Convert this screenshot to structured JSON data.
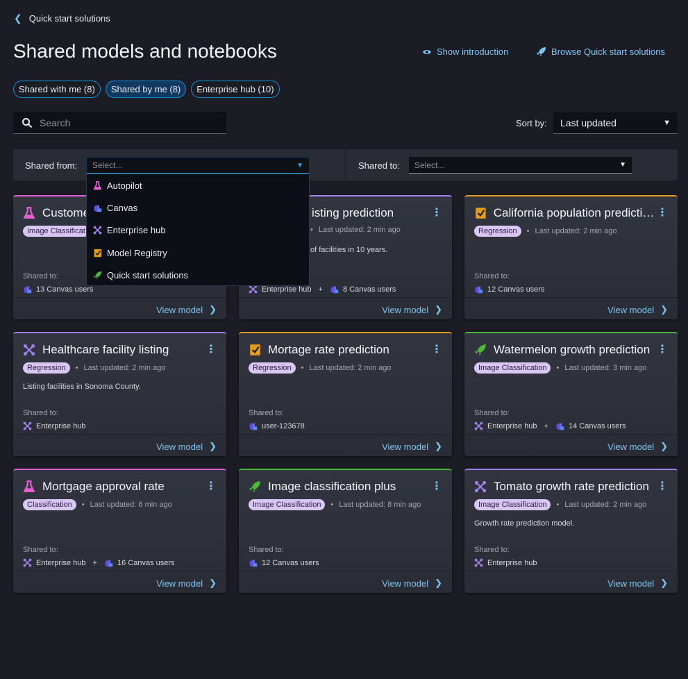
{
  "nav": {
    "back_label": "Quick start solutions"
  },
  "header": {
    "title": "Shared models and notebooks",
    "show_intro": "Show introduction",
    "browse": "Browse Quick start solutions"
  },
  "tabs": [
    {
      "label": "Shared with me (8)",
      "active": false
    },
    {
      "label": "Shared by me (8)",
      "active": true
    },
    {
      "label": "Enterprise hub (10)",
      "active": false
    }
  ],
  "search": {
    "placeholder": "Search"
  },
  "sort": {
    "label": "Sort by:",
    "value": "Last updated"
  },
  "filters": {
    "from_label": "Shared from:",
    "from_placeholder": "Select...",
    "to_label": "Shared to:",
    "to_placeholder": "Select..."
  },
  "dropdown": [
    {
      "icon": "autopilot",
      "label": "Autopilot"
    },
    {
      "icon": "canvas",
      "label": "Canvas"
    },
    {
      "icon": "hub",
      "label": "Enterprise hub"
    },
    {
      "icon": "registry",
      "label": "Model Registry"
    },
    {
      "icon": "quickstart",
      "label": "Quick start solutions"
    }
  ],
  "colors": {
    "autopilot": "#e45fd3",
    "hub": "#a37ff0",
    "registry": "#e39c1c",
    "quickstart": "#4bb83a",
    "canvas": "#6a5cf0",
    "link": "#7cc4f4"
  },
  "cards": [
    {
      "icon": "autopilot",
      "title": "Custome",
      "tag": "Image Classificat",
      "updated": "",
      "desc": "",
      "shared_label": "Shared to:",
      "shared": [
        {
          "icon": "canvas",
          "label": "13 Canvas users"
        }
      ],
      "view": "View model"
    },
    {
      "icon": "hub",
      "title": "isting prediction",
      "tag": "",
      "updated": "Last updated: 2 min ago",
      "desc": "of facilities in 10 years.",
      "shared_label": "Shared to:",
      "shared": [
        {
          "icon": "hub",
          "label": "Enterprise hub"
        },
        {
          "icon": "canvas",
          "label": "8 Canvas users"
        }
      ],
      "view": "View model",
      "partial": true
    },
    {
      "icon": "registry",
      "title": "California population predictio...",
      "tag": "Regression",
      "updated": "Last updated: 2 min ago",
      "desc": "",
      "shared_label": "Shared to:",
      "shared": [
        {
          "icon": "canvas",
          "label": "12 Canvas users"
        }
      ],
      "view": "View model"
    },
    {
      "icon": "hub",
      "title": "Healthcare facility listing",
      "tag": "Regression",
      "updated": "Last updated: 2 min ago",
      "desc": "Listing facilities in Sonoma County.",
      "shared_label": "Shared to:",
      "shared": [
        {
          "icon": "hub",
          "label": "Enterprise hub"
        }
      ],
      "view": "View model"
    },
    {
      "icon": "registry",
      "title": "Mortage rate prediction",
      "tag": "Regression",
      "updated": "Last updated: 2 min ago",
      "desc": "",
      "shared_label": "Shared to:",
      "shared": [
        {
          "icon": "canvas",
          "label": "user-123678"
        }
      ],
      "view": "View model"
    },
    {
      "icon": "quickstart",
      "title": "Watermelon growth prediction",
      "tag": "Image Classification",
      "updated": "Last updated: 3 min ago",
      "desc": "",
      "shared_label": "Shared to:",
      "shared": [
        {
          "icon": "hub",
          "label": "Enterprise hub"
        },
        {
          "icon": "canvas",
          "label": "14 Canvas users"
        }
      ],
      "view": "View model"
    },
    {
      "icon": "autopilot",
      "title": "Mortgage approval rate",
      "tag": "Classification",
      "updated": "Last updated: 6 min ago",
      "desc": "",
      "shared_label": "Shared to:",
      "shared": [
        {
          "icon": "hub",
          "label": "Enterprise hub"
        },
        {
          "icon": "canvas",
          "label": "16 Canvas users"
        }
      ],
      "view": "View model"
    },
    {
      "icon": "quickstart",
      "title": "Image classification plus",
      "tag": "Image Classification",
      "updated": "Last updated: 8 min ago",
      "desc": "",
      "shared_label": "Shared to:",
      "shared": [
        {
          "icon": "canvas",
          "label": "12 Canvas users"
        }
      ],
      "view": "View model"
    },
    {
      "icon": "hub",
      "title": "Tomato growth rate prediction",
      "tag": "Image Classification",
      "updated": "Last updated: 2 min ago",
      "desc": "Growth rate prediction model.",
      "shared_label": "Shared to:",
      "shared": [
        {
          "icon": "hub",
          "label": "Enterprise hub"
        }
      ],
      "view": "View model"
    }
  ]
}
